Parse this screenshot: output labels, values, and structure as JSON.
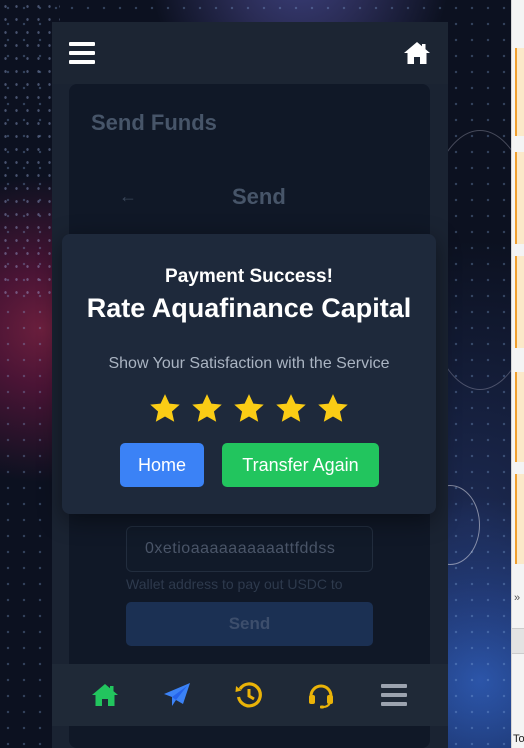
{
  "app": {
    "card_title": "Send Funds",
    "back_arrow": "←",
    "send_heading": "Send",
    "wallet_input_value": "0xetioaaaaaaaaaattfddss",
    "wallet_hint": "Wallet address to pay out USDC to",
    "send_button_label": "Send"
  },
  "modal": {
    "status": "Payment Success!",
    "title": "Rate Aquafinance Capital",
    "subtitle": "Show Your Satisfaction with the Service",
    "rating": 5,
    "rating_max": 5,
    "home_label": "Home",
    "transfer_again_label": "Transfer Again"
  },
  "side_strip": {
    "chevron": "»",
    "label": "To"
  },
  "icons": {
    "topbar": [
      "menu-icon",
      "home-icon"
    ],
    "bottom_nav": [
      "home-icon",
      "send-icon",
      "history-icon",
      "support-icon",
      "menu-icon"
    ]
  },
  "colors": {
    "nav_home": "#22c55e",
    "nav_send": "#3b82f6",
    "nav_history": "#eab308",
    "nav_support": "#eab308",
    "nav_menu": "#9ca3af",
    "star": "#facc15",
    "home_button": "#3b82f6",
    "transfer_button": "#22c55e"
  }
}
